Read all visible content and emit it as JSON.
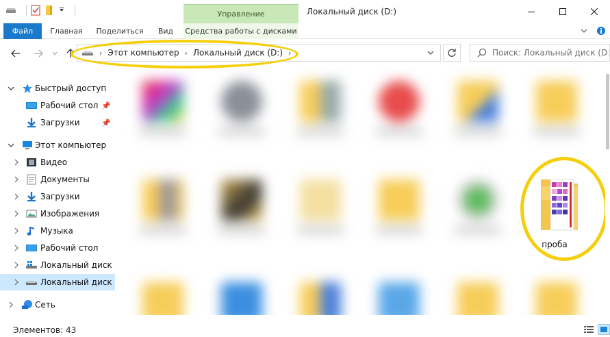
{
  "window": {
    "title": "Локальный диск (D:)"
  },
  "ribbon": {
    "context_group": "Управление",
    "tabs": [
      {
        "label": "Файл"
      },
      {
        "label": "Главная"
      },
      {
        "label": "Поделиться"
      },
      {
        "label": "Вид"
      },
      {
        "label": "Средства работы с дисками"
      }
    ]
  },
  "address": {
    "crumbs": [
      "Этот компьютер",
      "Локальный диск (D:)"
    ]
  },
  "search": {
    "placeholder": "Поиск: Локальный диск (D:)"
  },
  "sidebar": {
    "items": [
      {
        "label": "Быстрый доступ",
        "icon": "star-icon"
      },
      {
        "label": "Рабочий стол",
        "icon": "desktop-folder-icon"
      },
      {
        "label": "Загрузки",
        "icon": "downloads-icon"
      },
      {
        "label": "Этот компьютер",
        "icon": "computer-icon"
      },
      {
        "label": "Видео",
        "icon": "video-folder-icon"
      },
      {
        "label": "Документы",
        "icon": "documents-icon"
      },
      {
        "label": "Загрузки",
        "icon": "downloads-icon"
      },
      {
        "label": "Изображения",
        "icon": "pictures-icon"
      },
      {
        "label": "Музыка",
        "icon": "music-icon"
      },
      {
        "label": "Рабочий стол",
        "icon": "desktop-folder-icon"
      },
      {
        "label": "Локальный диск (C",
        "icon": "system-drive-icon"
      },
      {
        "label": "Локальный диск (D",
        "icon": "drive-icon"
      },
      {
        "label": "Сеть",
        "icon": "network-icon"
      }
    ]
  },
  "content": {
    "highlighted_folder": {
      "label": "проба"
    }
  },
  "status": {
    "count": "Элементов: 43"
  },
  "colors": {
    "accent": "#1979ca",
    "highlight": "#f5cf0e",
    "context": "#c8e8b8"
  }
}
